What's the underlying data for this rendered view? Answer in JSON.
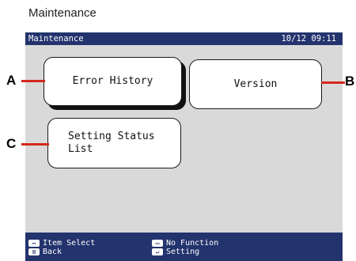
{
  "caption": "Maintenance",
  "screen": {
    "title": "Maintenance",
    "datetime": "10/12 09:11",
    "tiles": [
      {
        "label": "Error History"
      },
      {
        "label": "Version"
      },
      {
        "label": "Setting Status\nList"
      }
    ],
    "footer": [
      {
        "icon": "↔",
        "label": "Item Select"
      },
      {
        "icon": "⊠",
        "label": "Back"
      },
      {
        "icon": "▭",
        "label": "No Function"
      },
      {
        "icon": "↵",
        "label": "Setting"
      }
    ]
  },
  "callouts": [
    "A",
    "B",
    "C"
  ],
  "colors": {
    "titlebar": "#23336d",
    "screen_bg": "#d9d9d9",
    "callout_line": "#d4281e"
  }
}
